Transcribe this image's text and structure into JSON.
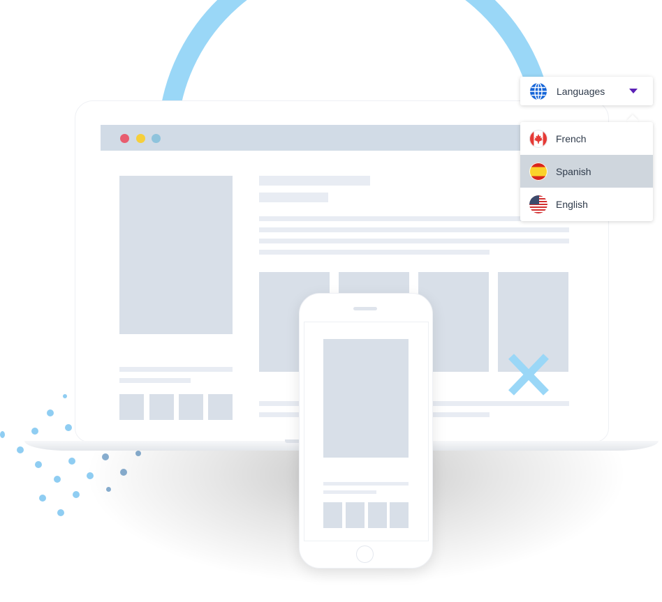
{
  "language_selector": {
    "trigger": {
      "icon": "globe-icon",
      "label": "Languages",
      "caret_icon": "caret-down-icon",
      "caret_color": "#5b21b6"
    },
    "options": [
      {
        "label": "French",
        "flag": "canada-flag-icon",
        "selected": false
      },
      {
        "label": "Spanish",
        "flag": "spain-flag-icon",
        "selected": true
      },
      {
        "label": "English",
        "flag": "usa-flag-icon",
        "selected": false
      }
    ]
  },
  "illustration": {
    "accent_color": "#9ad7f7",
    "placeholder_color": "#d8dfe8",
    "browser_bar_color": "#d1dbe6",
    "window_controls": [
      {
        "name": "close",
        "color": "#e85d6f"
      },
      {
        "name": "minimize",
        "color": "#f6cf3b"
      },
      {
        "name": "maximize",
        "color": "#8ec3dc"
      }
    ]
  }
}
